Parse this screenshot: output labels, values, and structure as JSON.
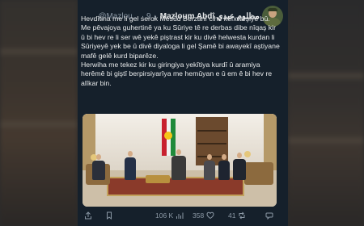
{
  "tweet": {
    "display_name": "Mazloum Abdî مظلوم عبدي",
    "handle_meta": "@Mazlou... · 9 د",
    "paragraphs": [
      "Hevdîtina me li gel serok Mesûd Berzanî cihê kêfxweşiyê bû.",
      "Me pêvajoya guhertinê ya ku Sûriye tê re derbas dibe nîqaş kir û bi hev re li ser wê yekê piştrast kir ku divê helwesta kurdan li Sûriyeyê yek be û divê diyaloga li gel Şamê bi awayekî aştiyane mafê gelê kurd biparêze.",
      "Herwiha me tekez kir ku giringiya yekîtiya kurdî û aramiya herêmê bi giştî berpirsiyarîya me hemûyan e û em ê bi hev re alîkar bin."
    ],
    "stats": {
      "views": "106 K",
      "retweets": "358",
      "likes": "41"
    }
  },
  "colors": {
    "tweet_bg": "#15202b",
    "text": "#e7e9ea",
    "muted": "#8b98a5"
  }
}
